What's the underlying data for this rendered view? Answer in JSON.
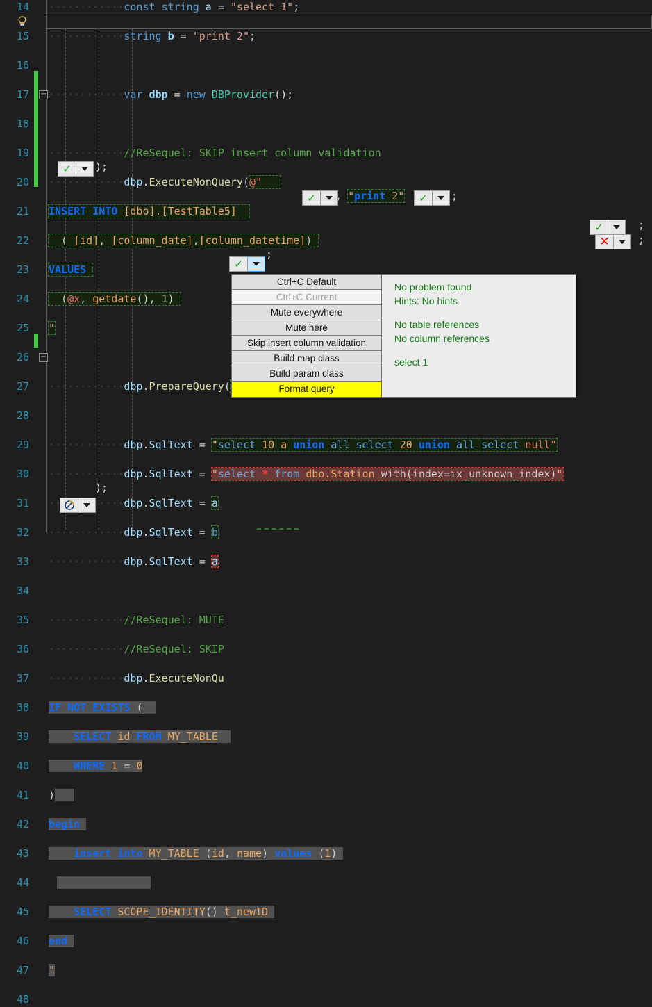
{
  "editor": {
    "first_line_number": 14,
    "last_line_number": 48,
    "lines": [
      {
        "n": 14,
        "text": "            const string a = \"select 1\";"
      },
      {
        "n": 15,
        "text": "            string b = \"print 2\";"
      },
      {
        "n": 16,
        "text": ""
      },
      {
        "n": 17,
        "text": "            var dbp = new DBProvider();"
      },
      {
        "n": 18,
        "text": ""
      },
      {
        "n": 19,
        "text": "            //ReSequel: SKIP insert column validation"
      },
      {
        "n": 20,
        "text": "            dbp.ExecuteNonQuery(@\""
      },
      {
        "n": 21,
        "text": "INSERT INTO [dbo].[TestTable5]"
      },
      {
        "n": 22,
        "text": "  ( [id], [column_date],[column_datetime])"
      },
      {
        "n": 23,
        "text": "VALUES"
      },
      {
        "n": 24,
        "text": "  (@x, getdate(), 1)"
      },
      {
        "n": 25,
        "text": "\"  );"
      },
      {
        "n": 26,
        "text": ""
      },
      {
        "n": 27,
        "text": "            dbp.PrepareQuery(\"print 1\"  , \"print 2\"  );"
      },
      {
        "n": 28,
        "text": ""
      },
      {
        "n": 29,
        "text": "            dbp.SqlText = \"select 10 a union all select 20 union all select null\"  ;"
      },
      {
        "n": 30,
        "text": "            dbp.SqlText = \"select * from dbo.Station with(index=ix_unknown_index)\"  ;"
      },
      {
        "n": 31,
        "text": "            dbp.SqlText = a  ;"
      },
      {
        "n": 32,
        "text": "            dbp.SqlText = b"
      },
      {
        "n": 33,
        "text": "            dbp.SqlText = a"
      },
      {
        "n": 34,
        "text": ""
      },
      {
        "n": 35,
        "text": "            //ReSequel: MUTE"
      },
      {
        "n": 36,
        "text": "            //ReSequel: SKIP"
      },
      {
        "n": 37,
        "text": "            dbp.ExecuteNonQu"
      },
      {
        "n": 38,
        "text": "IF NOT EXISTS ("
      },
      {
        "n": 39,
        "text": "    SELECT id FROM MY_TABLE"
      },
      {
        "n": 40,
        "text": "    WHERE 1 = 0"
      },
      {
        "n": 41,
        "text": ")"
      },
      {
        "n": 42,
        "text": "begin"
      },
      {
        "n": 43,
        "text": "    insert into MY_TABLE (id, name) values (1)"
      },
      {
        "n": 44,
        "text": ""
      },
      {
        "n": 45,
        "text": "    SELECT SCOPE_IDENTITY() t_newID"
      },
      {
        "n": 46,
        "text": "end"
      },
      {
        "n": 47,
        "text": "\"  );"
      },
      {
        "n": 48,
        "text": ""
      }
    ]
  },
  "icons": {
    "lightbulb": "lightbulb-icon",
    "fold_collapse": "−",
    "tick": "✓",
    "cross": "✕",
    "mute": "mute-icon"
  },
  "context_menu": {
    "items": [
      {
        "label": "Ctrl+C Default",
        "state": "normal"
      },
      {
        "label": "Ctrl+C Current",
        "state": "disabled"
      },
      {
        "label": "Mute everywhere",
        "state": "normal"
      },
      {
        "label": "Mute here",
        "state": "normal"
      },
      {
        "label": "Skip insert column validation",
        "state": "normal"
      },
      {
        "label": "Build map class",
        "state": "normal"
      },
      {
        "label": "Build param class",
        "state": "normal"
      },
      {
        "label": "Format query",
        "state": "highlighted"
      }
    ],
    "highlight_color": "#ffff00"
  },
  "info_panel": {
    "lines": [
      "No problem found",
      "Hints: No hints",
      "",
      "No table references",
      "No column references",
      "",
      "select 1"
    ],
    "text_color": "#137a13"
  },
  "colors": {
    "editor_background": "#1e1e1e",
    "line_number": "#2b91af",
    "change_bar_green": "#3ec93e",
    "sql_ok_background": "#16240f",
    "sql_ok_border": "#2e7d32",
    "sql_error_background": "#6b3a38",
    "sql_error_border": "#ff2f2f",
    "selection": "#515151",
    "menu_background": "#e0e0e0",
    "panel_background": "#ececed"
  }
}
